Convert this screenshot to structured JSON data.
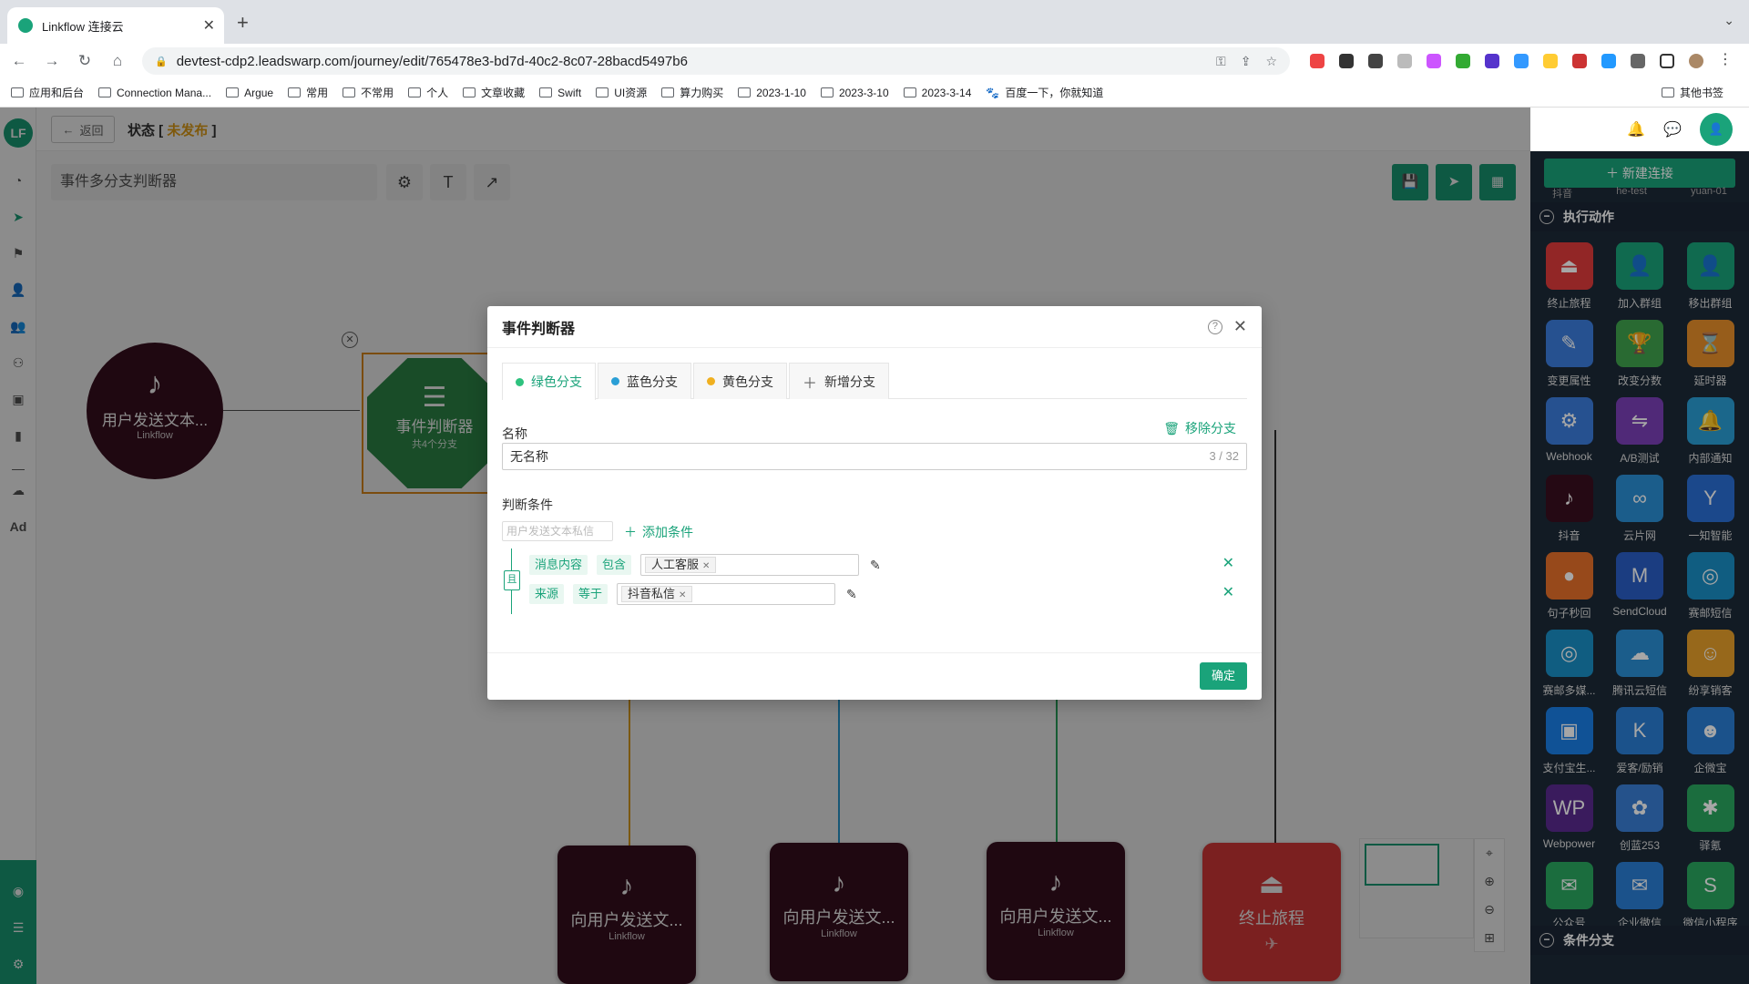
{
  "browser": {
    "tab_title": "Linkflow 连接云",
    "url": "devtest-cdp2.leadswarp.com/journey/edit/765478e3-bd7d-40c2-8c07-28bacd5497b6",
    "bookmarks": [
      "应用和后台",
      "Connection Mana...",
      "Argue",
      "常用",
      "不常用",
      "个人",
      "文章收藏",
      "Swift",
      "UI资源",
      "算力购买",
      "2023-1-10",
      "2023-3-10",
      "2023-3-14",
      "百度一下，你就知道"
    ],
    "other_bookmarks": "其他书签"
  },
  "app": {
    "back_label": "返回",
    "status_prefix": "状态 [ ",
    "status_value": "未发布",
    "status_suffix": " ]",
    "journey_name": "事件多分支判断器",
    "new_connection": "＋ 新建连接",
    "prev_labels": [
      "抖音",
      "he-test",
      "yuan-01"
    ]
  },
  "canvas": {
    "trigger": {
      "name": "用户发送文本...",
      "sub": "Linkflow"
    },
    "judge": {
      "name": "事件判断器",
      "sub": "共4个分支"
    },
    "branch_nodes": [
      {
        "name": "向用户发送文...",
        "sub": "Linkflow"
      },
      {
        "name": "向用户发送文...",
        "sub": "Linkflow"
      },
      {
        "name": "向用户发送文...",
        "sub": "Linkflow"
      },
      {
        "name": "终止旅程",
        "sub": "✈"
      }
    ],
    "branch_colors": [
      "#e0a020",
      "#2a9fd6",
      "#2aa860",
      "#333333"
    ]
  },
  "panel": {
    "section_actions": "执行动作",
    "section_branch": "条件分支",
    "items": [
      {
        "label": "终止旅程",
        "color": "#e03b3b",
        "icon": "⏏"
      },
      {
        "label": "加入群组",
        "color": "#1aa37a",
        "icon": "👤"
      },
      {
        "label": "移出群组",
        "color": "#1aa37a",
        "icon": "👤"
      },
      {
        "label": "变更属性",
        "color": "#3b7ddd",
        "icon": "✎"
      },
      {
        "label": "改变分数",
        "color": "#3fa34d",
        "icon": "🏆"
      },
      {
        "label": "延时器",
        "color": "#e8902a",
        "icon": "⌛"
      },
      {
        "label": "Webhook",
        "color": "#3b7ddd",
        "icon": "⚙"
      },
      {
        "label": "A/B测试",
        "color": "#7b3fb8",
        "icon": "⇋"
      },
      {
        "label": "内部通知",
        "color": "#2a9fd6",
        "icon": "🔔"
      },
      {
        "label": "抖音",
        "color": "#3a0f1f",
        "icon": "♪"
      },
      {
        "label": "云片网",
        "color": "#2a8fd6",
        "icon": "∞"
      },
      {
        "label": "一知智能",
        "color": "#2a6fd6",
        "icon": "Y"
      },
      {
        "label": "句子秒回",
        "color": "#e8702a",
        "icon": "●"
      },
      {
        "label": "SendCloud",
        "color": "#2a5fc6",
        "icon": "M"
      },
      {
        "label": "赛邮短信",
        "color": "#1a8fc6",
        "icon": "◎"
      },
      {
        "label": "赛邮多媒...",
        "color": "#1a8fc6",
        "icon": "◎"
      },
      {
        "label": "腾讯云短信",
        "color": "#2a8fd6",
        "icon": "☁"
      },
      {
        "label": "纷享销客",
        "color": "#e8a02a",
        "icon": "☺"
      },
      {
        "label": "支付宝生...",
        "color": "#1a7fe6",
        "icon": "▣"
      },
      {
        "label": "爱客/励销",
        "color": "#2a7fd6",
        "icon": "K"
      },
      {
        "label": "企微宝",
        "color": "#2a7fd6",
        "icon": "☻"
      },
      {
        "label": "Webpower",
        "color": "#5a2a8f",
        "icon": "WP"
      },
      {
        "label": "创蓝253",
        "color": "#3a7fd6",
        "icon": "✿"
      },
      {
        "label": "驿氪",
        "color": "#2aa860",
        "icon": "✱"
      },
      {
        "label": "公众号",
        "color": "#2aa860",
        "icon": "✉"
      },
      {
        "label": "企业微信",
        "color": "#2a7fd6",
        "icon": "✉"
      },
      {
        "label": "微信小程序",
        "color": "#2aa860",
        "icon": "S"
      }
    ]
  },
  "dialog": {
    "title": "事件判断器",
    "tabs": [
      {
        "label": "绿色分支",
        "color": "#2ec27e"
      },
      {
        "label": "蓝色分支",
        "color": "#2a9fd6"
      },
      {
        "label": "黄色分支",
        "color": "#f0b020"
      }
    ],
    "add_tab": "新增分支",
    "name_label": "名称",
    "remove_branch": "移除分支",
    "name_value": "无名称",
    "name_count": "3 / 32",
    "cond_label": "判断条件",
    "cond_select": "用户发送文本私信",
    "add_condition": "添加条件",
    "logic": "且",
    "conditions": [
      {
        "field": "消息内容",
        "op": "包含",
        "value": "人工客服"
      },
      {
        "field": "来源",
        "op": "等于",
        "value": "抖音私信"
      }
    ],
    "ok": "确定"
  }
}
